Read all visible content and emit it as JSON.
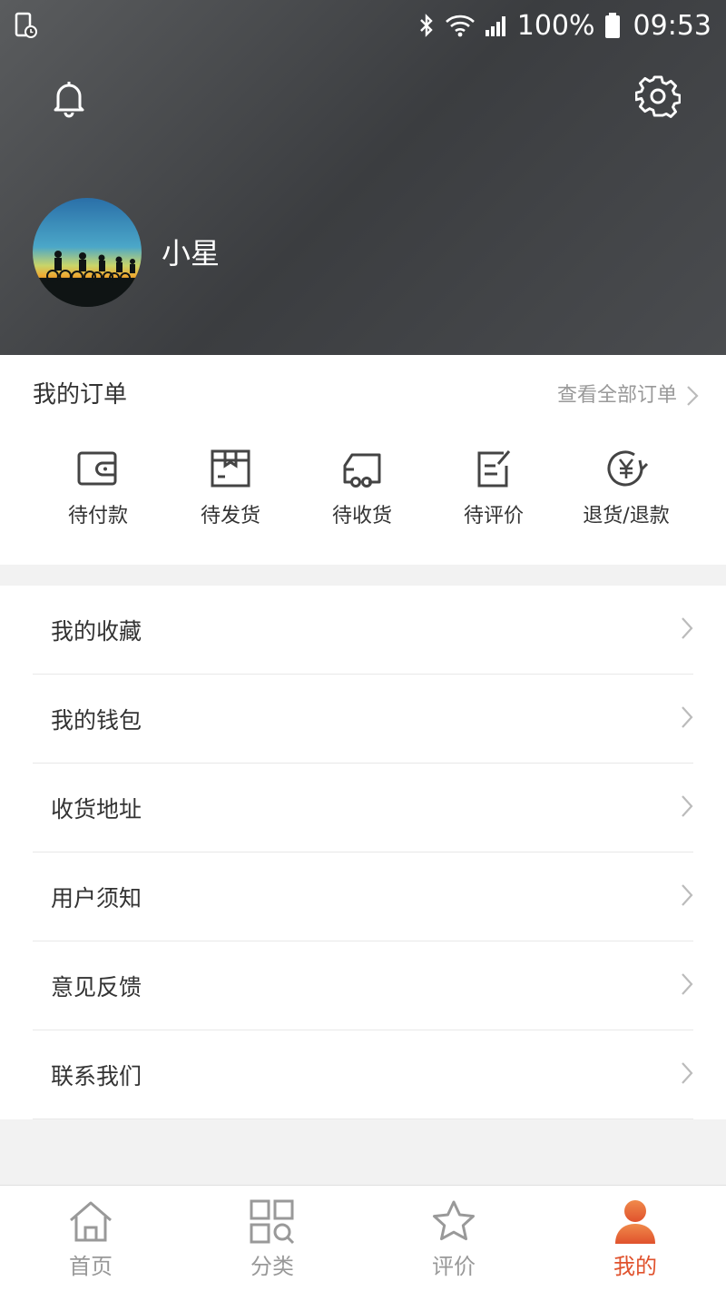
{
  "status_bar": {
    "battery": "100%",
    "time": "09:53"
  },
  "profile": {
    "username": "小星"
  },
  "orders": {
    "title": "我的订单",
    "view_all": "查看全部订单",
    "items": [
      {
        "label": "待付款",
        "icon": "wallet-icon"
      },
      {
        "label": "待发货",
        "icon": "box-icon"
      },
      {
        "label": "待收货",
        "icon": "truck-icon"
      },
      {
        "label": "待评价",
        "icon": "edit-note-icon"
      },
      {
        "label": "退货/退款",
        "icon": "refund-yen-icon"
      }
    ]
  },
  "menu": [
    {
      "label": "我的收藏"
    },
    {
      "label": "我的钱包"
    },
    {
      "label": "收货地址"
    },
    {
      "label": "用户须知"
    },
    {
      "label": "意见反馈"
    },
    {
      "label": "联系我们"
    }
  ],
  "tabbar": [
    {
      "label": "首页",
      "icon": "home-icon"
    },
    {
      "label": "分类",
      "icon": "category-icon"
    },
    {
      "label": "评价",
      "icon": "star-icon"
    },
    {
      "label": "我的",
      "icon": "user-icon",
      "active": true
    }
  ],
  "colors": {
    "accent": "#e0522d",
    "header": "#46484b"
  }
}
